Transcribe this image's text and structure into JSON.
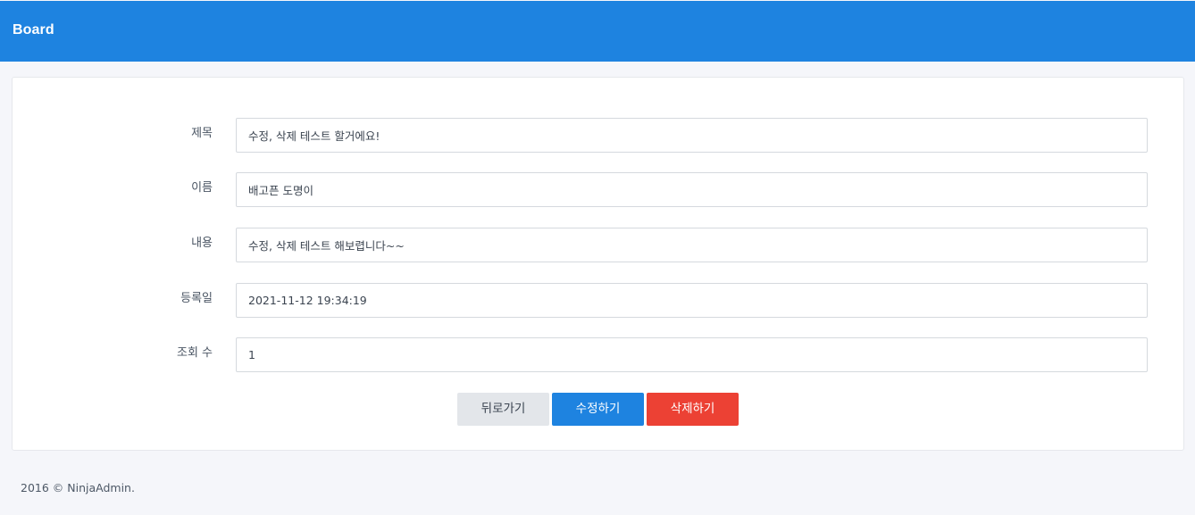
{
  "header": {
    "title": "Board"
  },
  "form": {
    "fields": [
      {
        "label": "제목",
        "value": "수정, 삭제 테스트 할거에요!"
      },
      {
        "label": "이름",
        "value": "배고픈 도명이"
      },
      {
        "label": "내용",
        "value": "수정, 삭제 테스트 해보렵니다~~"
      },
      {
        "label": "등록일",
        "value": "2021-11-12 19:34:19"
      },
      {
        "label": "조회 수",
        "value": "1"
      }
    ]
  },
  "actions": {
    "back_label": "뒤로가기",
    "edit_label": "수정하기",
    "delete_label": "삭제하기"
  },
  "footer": {
    "copyright": "2016 © NinjaAdmin."
  },
  "colors": {
    "header_bg": "#1e83e0",
    "primary": "#1e83e0",
    "danger": "#ec4134",
    "secondary": "#e3e6ea",
    "page_bg": "#f5f6fa"
  }
}
